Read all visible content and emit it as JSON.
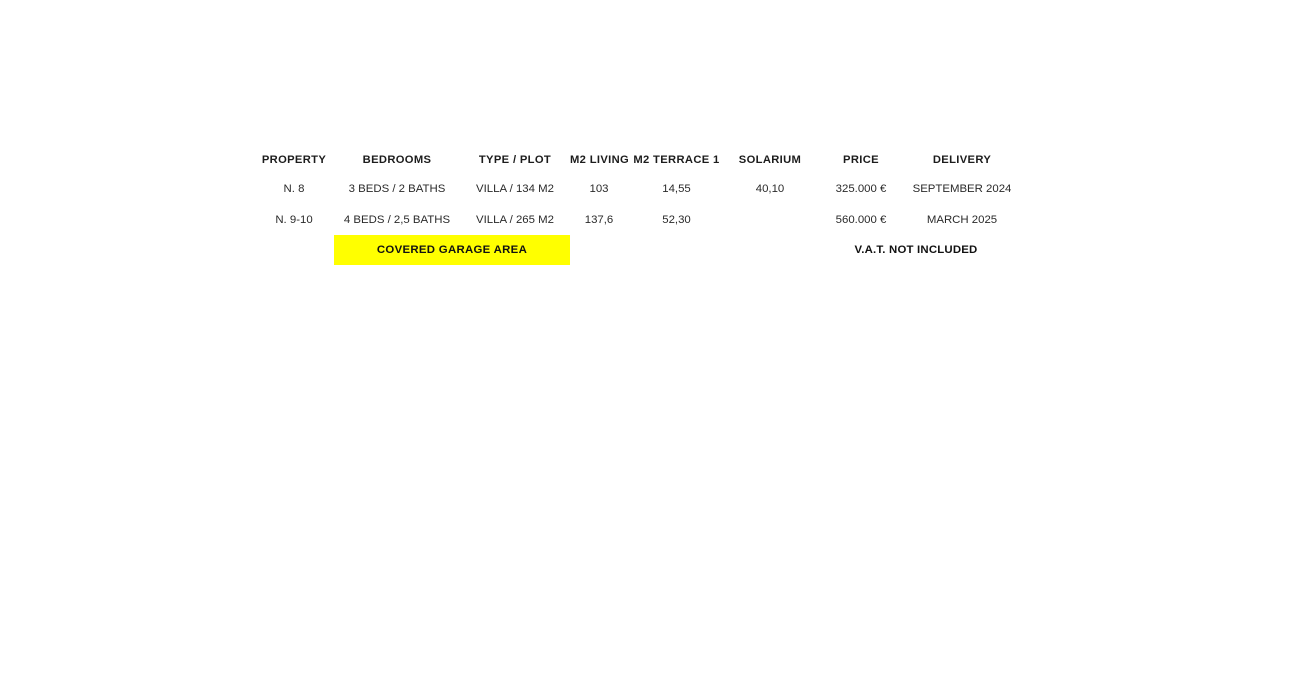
{
  "document": {
    "background_color": "#ffffff",
    "text_color": "#1a1a1a",
    "highlight_color": "#FFFF00"
  },
  "table": {
    "headers": [
      "PROPERTY",
      "BEDROOMS",
      "TYPE / PLOT",
      "M2 LIVING",
      "M2 TERRACE 1",
      "SOLARIUM",
      "PRICE",
      "DELIVERY"
    ],
    "rows": [
      {
        "property": "N. 8",
        "bedrooms": "3 BEDS / 2 BATHS",
        "type_plot": "VILLA / 134 M2",
        "m2_living": "103",
        "m2_terrace_1": "14,55",
        "solarium": "40,10",
        "price": "325.000 €",
        "delivery": "SEPTEMBER 2024"
      },
      {
        "property": "N. 9-10",
        "bedrooms": "4 BEDS / 2,5 BATHS",
        "type_plot": "VILLA / 265 M2",
        "m2_living": "137,6",
        "m2_terrace_1": "52,30",
        "solarium": "",
        "price": "560.000 €",
        "delivery": "MARCH 2025"
      }
    ],
    "footer": {
      "garage_note": "COVERED GARAGE AREA",
      "vat_note": "V.A.T. NOT INCLUDED"
    }
  }
}
